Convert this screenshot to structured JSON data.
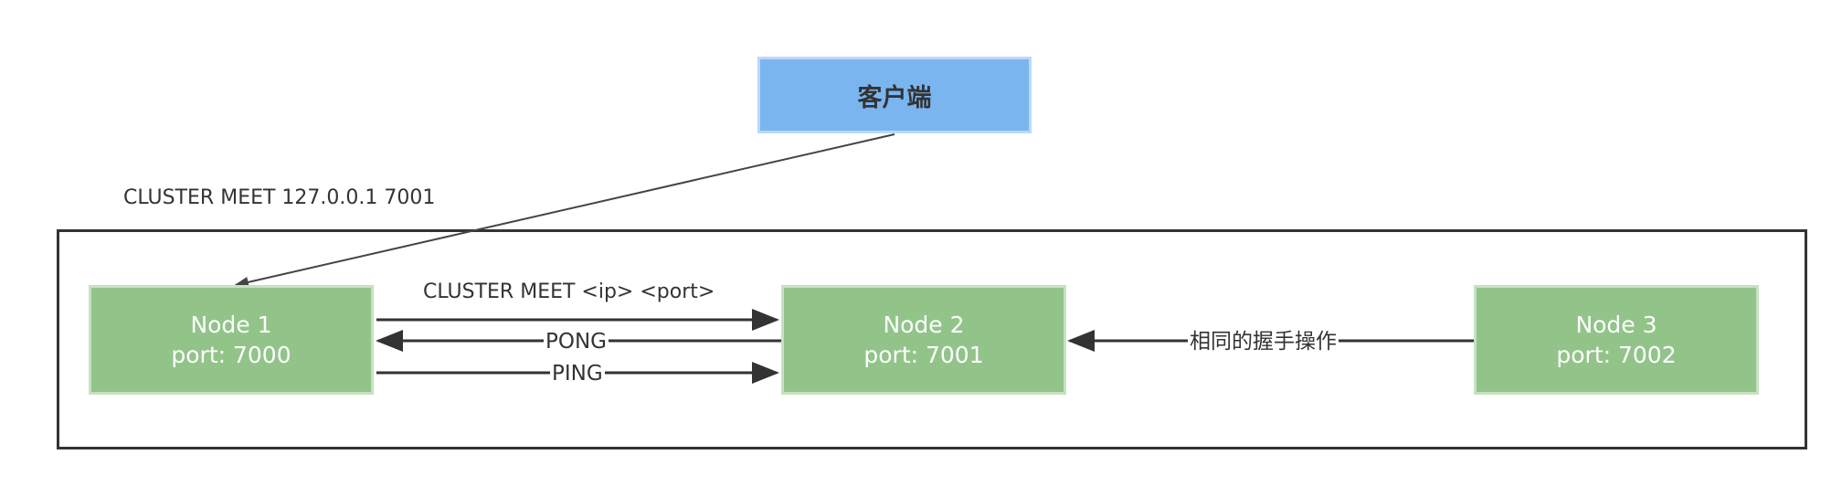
{
  "diagram": {
    "client": {
      "label": "客户端"
    },
    "cluster_command": "CLUSTER MEET 127.0.0.1 7001",
    "nodes": [
      {
        "name": "Node 1",
        "port": "port: 7000"
      },
      {
        "name": "Node 2",
        "port": "port: 7001"
      },
      {
        "name": "Node 3",
        "port": "port: 7002"
      }
    ],
    "edges": {
      "meet": "CLUSTER MEET <ip> <port>",
      "pong": "PONG",
      "ping": "PING",
      "same_handshake": "相同的握手操作"
    },
    "colors": {
      "client_fill": "#7ab5f0",
      "node_fill": "#92c48a",
      "line": "#333333"
    }
  }
}
